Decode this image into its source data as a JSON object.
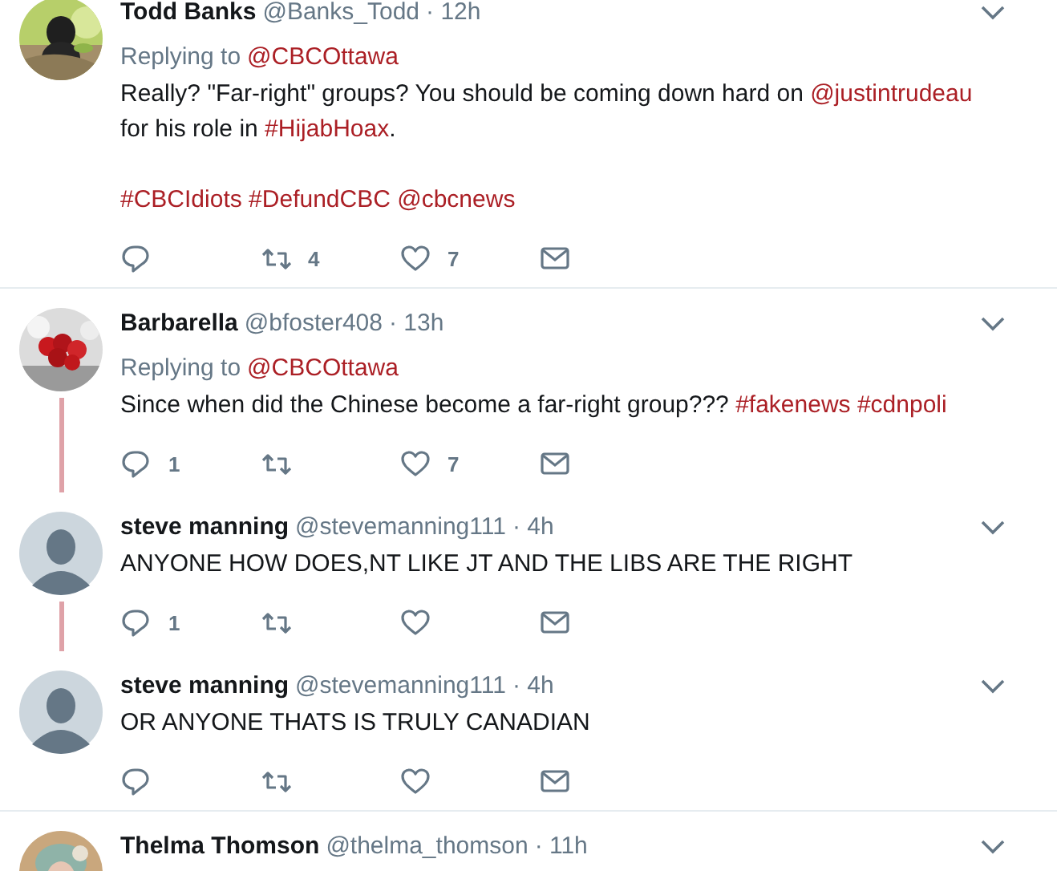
{
  "tweets": [
    {
      "avatar": {
        "kind": "picture"
      },
      "name": "Todd Banks",
      "handle": "@Banks_Todd",
      "time": "· 12h",
      "replying_label": "Replying to",
      "replying_to": "@CBCOttawa",
      "thread_below": false,
      "divider_below": true,
      "paragraphs": [
        [
          {
            "kind": "text",
            "text": "Really? \"Far-right\" groups? You should be coming down hard on "
          },
          {
            "kind": "link",
            "text": "@justintrudeau"
          },
          {
            "kind": "text",
            "text": " for his role in "
          },
          {
            "kind": "link",
            "text": "#HijabHoax"
          },
          {
            "kind": "text",
            "text": "."
          }
        ],
        [
          {
            "kind": "link",
            "text": "#CBCIdiots"
          },
          {
            "kind": "link",
            "text": "#DefundCBC"
          },
          {
            "kind": "link",
            "text": "@cbcnews"
          }
        ]
      ],
      "retweets": "4",
      "likes": "7"
    },
    {
      "avatar": {
        "kind": "picture"
      },
      "name": "Barbarella",
      "handle": "@bfoster408",
      "time": "· 13h",
      "replying_label": "Replying to",
      "replying_to": "@CBCOttawa",
      "thread_below": true,
      "divider_below": false,
      "paragraphs": [
        [
          {
            "kind": "text",
            "text": "Since when did the Chinese become a far-right group??? "
          },
          {
            "kind": "link",
            "text": "#fakenews"
          },
          {
            "kind": "link",
            "text": "#cdnpoli"
          }
        ]
      ],
      "replies": "1",
      "likes": "7"
    },
    {
      "avatar": {
        "kind": "default"
      },
      "name": "steve manning",
      "handle": "@stevemanning111",
      "time": "· 4h",
      "thread_below": true,
      "divider_below": false,
      "paragraphs": [
        [
          {
            "kind": "text",
            "text": "ANYONE HOW DOES,NT LIKE JT AND THE LIBS ARE THE RIGHT"
          }
        ]
      ],
      "replies": "1"
    },
    {
      "avatar": {
        "kind": "default"
      },
      "name": "steve manning",
      "handle": "@stevemanning111",
      "time": "· 4h",
      "thread_below": false,
      "divider_below": true,
      "paragraphs": [
        [
          {
            "kind": "text",
            "text": "OR ANYONE THATS IS TRULY CANADIAN"
          }
        ]
      ]
    },
    {
      "avatar": {
        "kind": "picture"
      },
      "name": "Thelma Thomson",
      "handle": "@thelma_thomson",
      "time": "· 11h"
    }
  ]
}
